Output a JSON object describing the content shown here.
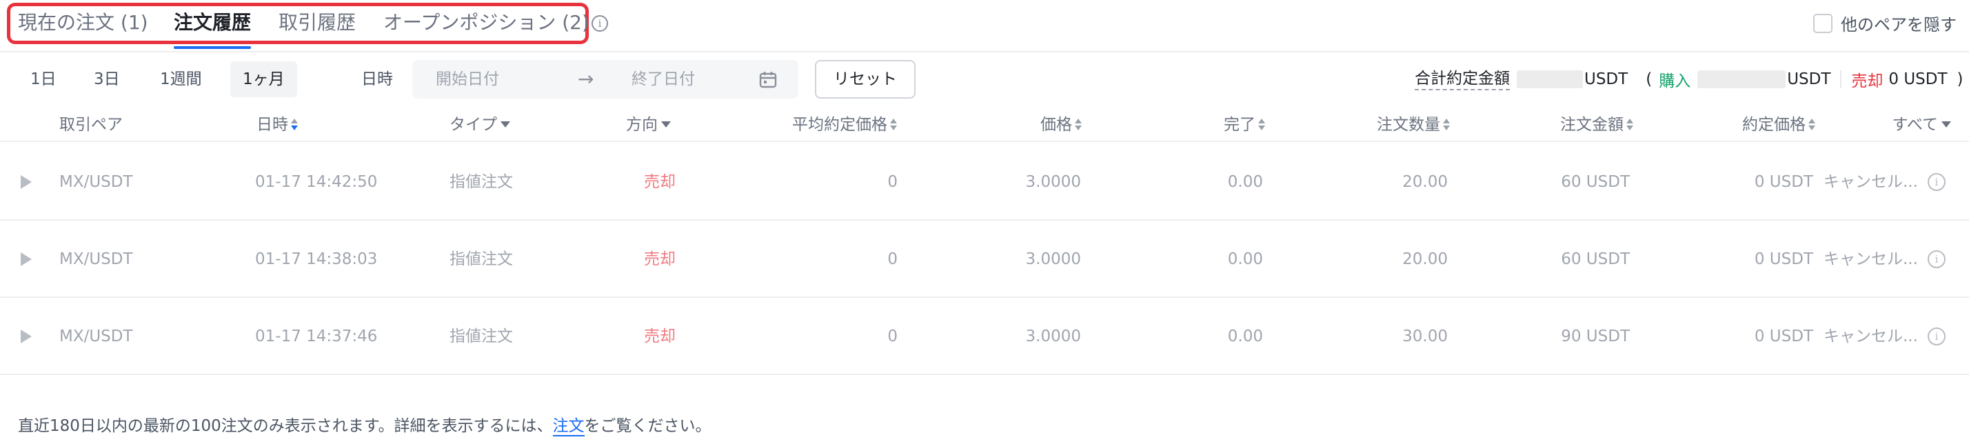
{
  "tabs": [
    {
      "label": "現在の注文 (1)"
    },
    {
      "label": "注文履歴"
    },
    {
      "label": "取引履歴"
    },
    {
      "label": "オープンポジション (2)"
    }
  ],
  "hide_pairs_label": "他のペアを隠す",
  "periods": [
    "1日",
    "3日",
    "1週間",
    "1ヶ月"
  ],
  "active_period": "1ヶ月",
  "date_filter": {
    "label": "日時",
    "start_placeholder": "開始日付",
    "arrow": "→",
    "end_placeholder": "終了日付"
  },
  "reset_label": "リセット",
  "totals": {
    "label": "合計約定金額",
    "unit_1": "USDT",
    "open_paren": "(",
    "buy_label": "購入",
    "unit_2": "USDT",
    "sell_label": "売却",
    "sell_value": "0 USDT",
    "close_paren": ")"
  },
  "table": {
    "headers": {
      "pair": "取引ペア",
      "time": "日時",
      "type": "タイプ",
      "side": "方向",
      "avg_price": "平均約定価格",
      "price": "価格",
      "filled": "完了",
      "amount": "注文数量",
      "total": "注文金額",
      "executed": "約定価格",
      "status": "すべて"
    },
    "rows": [
      {
        "pair": "MX/USDT",
        "time": "01-17 14:42:50",
        "type": "指値注文",
        "side": "売却",
        "avg_price": "0",
        "price": "3.0000",
        "filled": "0.00",
        "amount": "20.00",
        "total": "60 USDT",
        "executed": "0 USDT",
        "status": "キャンセル..."
      },
      {
        "pair": "MX/USDT",
        "time": "01-17 14:38:03",
        "type": "指値注文",
        "side": "売却",
        "avg_price": "0",
        "price": "3.0000",
        "filled": "0.00",
        "amount": "20.00",
        "total": "60 USDT",
        "executed": "0 USDT",
        "status": "キャンセル..."
      },
      {
        "pair": "MX/USDT",
        "time": "01-17 14:37:46",
        "type": "指値注文",
        "side": "売却",
        "avg_price": "0",
        "price": "3.0000",
        "filled": "0.00",
        "amount": "30.00",
        "total": "90 USDT",
        "executed": "0 USDT",
        "status": "キャンセル..."
      }
    ]
  },
  "footer": {
    "note_before": "直近180日以内の最新の100注文のみ表示されます。詳細を表示するには、",
    "link": "注文",
    "note_after": "をご覧ください。"
  },
  "colors": {
    "accent": "#1a6cf2",
    "highlight_border": "#e8323c",
    "buy": "#13a36a",
    "sell": "#e8323c"
  }
}
